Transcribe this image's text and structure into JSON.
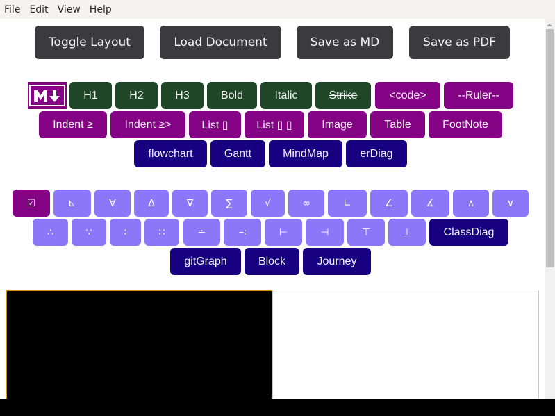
{
  "menu": [
    "File",
    "Edit",
    "View",
    "Help"
  ],
  "toolbar": {
    "toggle_layout": "Toggle Layout",
    "load_document": "Load Document",
    "save_md": "Save as MD",
    "save_pdf": "Save as PDF"
  },
  "format_buttons": {
    "h1": "H1",
    "h2": "H2",
    "h3": "H3",
    "bold": "Bold",
    "italic": "Italic",
    "strike": "Strike",
    "code": "<code>",
    "ruler": "--Ruler--",
    "indent1": "Indent ≥",
    "indent2": "Indent ≥>",
    "list1": "List ▯",
    "list2": "List ▯ ▯",
    "image": "Image",
    "table": "Table",
    "footnote": "FootNote"
  },
  "diagram_buttons": {
    "flowchart": "flowchart",
    "gantt": "Gantt",
    "mindmap": "MindMap",
    "erdiag": "erDiag",
    "classdiag": "ClassDiag",
    "gitgraph": "gitGraph",
    "block": "Block",
    "journey": "Journey"
  },
  "symbols_row1": [
    "☑",
    "⊾",
    "∀",
    "∆",
    "∇",
    "∑",
    "√",
    "∞",
    "∟",
    "∠",
    "∡",
    "∧",
    "∨"
  ],
  "symbols_row2": [
    "∴",
    "∵",
    "∶",
    "∷",
    "∸",
    "∹",
    "⊢",
    "⊣",
    "⊤",
    "⊥"
  ],
  "colors": {
    "format_green": "#1e4627",
    "accent_purple": "#830384",
    "diagram_navy": "#170180",
    "symbol_lavender": "#8b77f7",
    "toolbar_dark": "#3b3b3d",
    "editor_focus_border": "#d4930a"
  },
  "logo": "markdown-logo"
}
